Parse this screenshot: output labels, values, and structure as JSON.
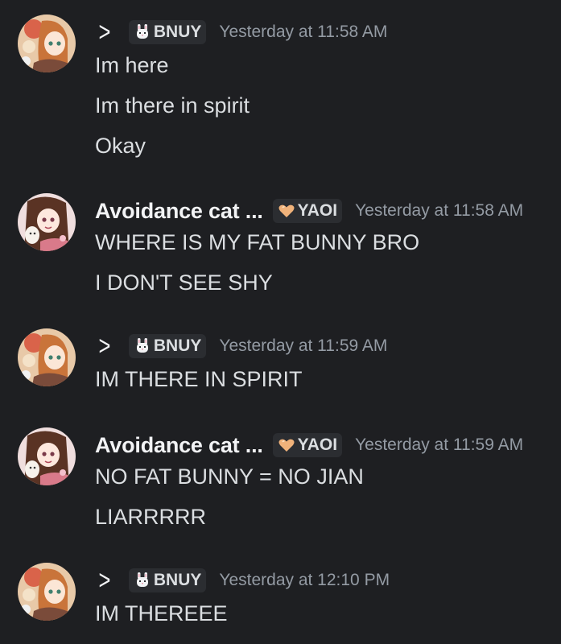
{
  "messages": [
    {
      "username": "",
      "username_glyph": ">",
      "tag": "BNUY",
      "tag_icon": "bunny-icon",
      "timestamp": "Yesterday at 11:58 AM",
      "lines": [
        "Im here",
        "Im there in spirit",
        "Okay"
      ]
    },
    {
      "username": "Avoidance cat ...",
      "tag": "YAOI",
      "tag_icon": "heart-icon",
      "timestamp": "Yesterday at 11:58 AM",
      "lines": [
        "WHERE IS MY FAT BUNNY BRO",
        "I DON'T SEE SHY"
      ]
    },
    {
      "username": "",
      "username_glyph": ">",
      "tag": "BNUY",
      "tag_icon": "bunny-icon",
      "timestamp": "Yesterday at 11:59 AM",
      "lines": [
        "IM THERE IN SPIRIT"
      ]
    },
    {
      "username": "Avoidance cat ...",
      "tag": "YAOI",
      "tag_icon": "heart-icon",
      "timestamp": "Yesterday at 11:59 AM",
      "lines": [
        "NO FAT BUNNY = NO JIAN",
        "LIARRRRR"
      ]
    },
    {
      "username": "",
      "username_glyph": ">",
      "tag": "BNUY",
      "tag_icon": "bunny-icon",
      "timestamp": "Yesterday at 12:10 PM",
      "lines": [
        "IM THEREEE"
      ]
    }
  ],
  "colors": {
    "background": "#1e1f22",
    "text": "#dbdee1",
    "username": "#f2f3f5",
    "timestamp": "#949ba4",
    "tag_background": "#2b2d31",
    "heart": "#f0b27a"
  }
}
